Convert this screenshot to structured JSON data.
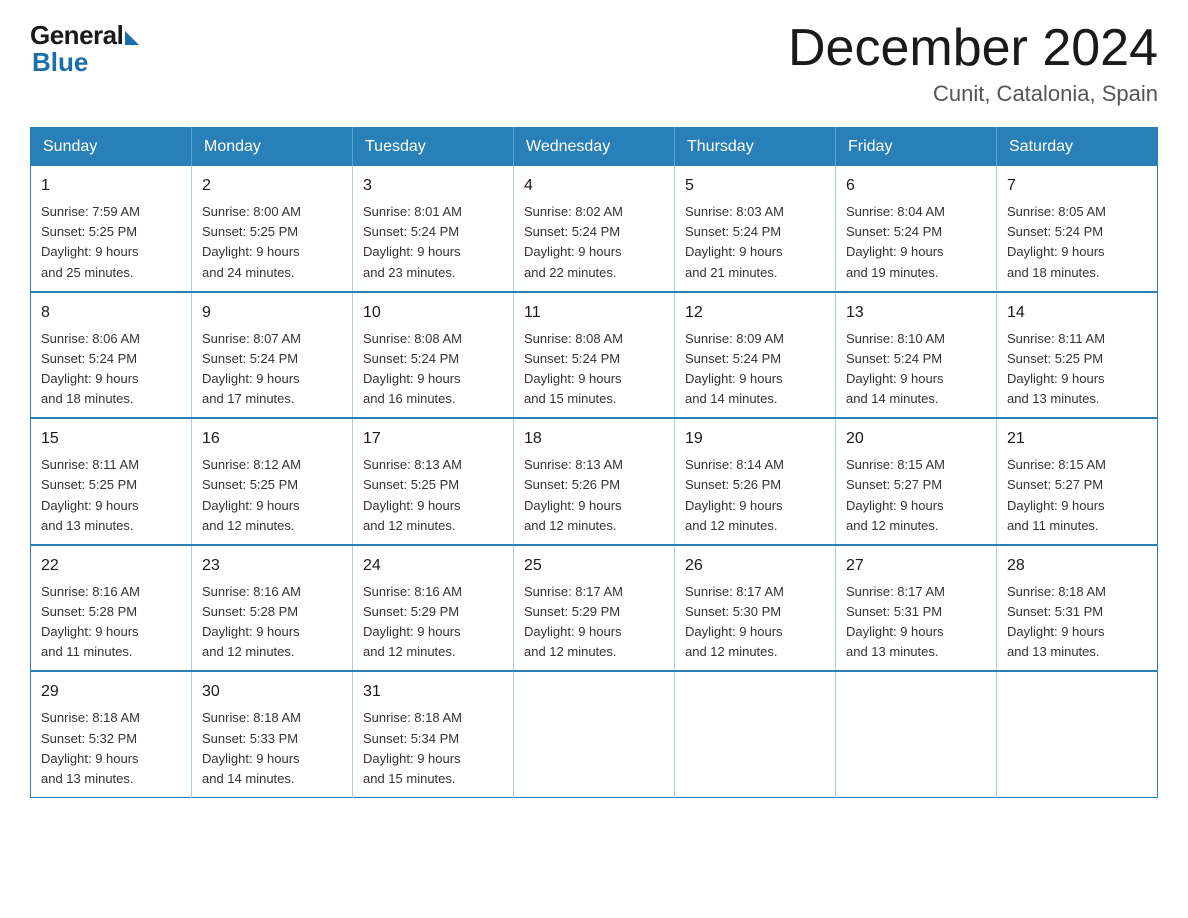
{
  "logo": {
    "general": "General",
    "blue": "Blue"
  },
  "title": "December 2024",
  "location": "Cunit, Catalonia, Spain",
  "days_of_week": [
    "Sunday",
    "Monday",
    "Tuesday",
    "Wednesday",
    "Thursday",
    "Friday",
    "Saturday"
  ],
  "weeks": [
    [
      {
        "day": "1",
        "sunrise": "7:59 AM",
        "sunset": "5:25 PM",
        "daylight": "9 hours and 25 minutes."
      },
      {
        "day": "2",
        "sunrise": "8:00 AM",
        "sunset": "5:25 PM",
        "daylight": "9 hours and 24 minutes."
      },
      {
        "day": "3",
        "sunrise": "8:01 AM",
        "sunset": "5:24 PM",
        "daylight": "9 hours and 23 minutes."
      },
      {
        "day": "4",
        "sunrise": "8:02 AM",
        "sunset": "5:24 PM",
        "daylight": "9 hours and 22 minutes."
      },
      {
        "day": "5",
        "sunrise": "8:03 AM",
        "sunset": "5:24 PM",
        "daylight": "9 hours and 21 minutes."
      },
      {
        "day": "6",
        "sunrise": "8:04 AM",
        "sunset": "5:24 PM",
        "daylight": "9 hours and 19 minutes."
      },
      {
        "day": "7",
        "sunrise": "8:05 AM",
        "sunset": "5:24 PM",
        "daylight": "9 hours and 18 minutes."
      }
    ],
    [
      {
        "day": "8",
        "sunrise": "8:06 AM",
        "sunset": "5:24 PM",
        "daylight": "9 hours and 18 minutes."
      },
      {
        "day": "9",
        "sunrise": "8:07 AM",
        "sunset": "5:24 PM",
        "daylight": "9 hours and 17 minutes."
      },
      {
        "day": "10",
        "sunrise": "8:08 AM",
        "sunset": "5:24 PM",
        "daylight": "9 hours and 16 minutes."
      },
      {
        "day": "11",
        "sunrise": "8:08 AM",
        "sunset": "5:24 PM",
        "daylight": "9 hours and 15 minutes."
      },
      {
        "day": "12",
        "sunrise": "8:09 AM",
        "sunset": "5:24 PM",
        "daylight": "9 hours and 14 minutes."
      },
      {
        "day": "13",
        "sunrise": "8:10 AM",
        "sunset": "5:24 PM",
        "daylight": "9 hours and 14 minutes."
      },
      {
        "day": "14",
        "sunrise": "8:11 AM",
        "sunset": "5:25 PM",
        "daylight": "9 hours and 13 minutes."
      }
    ],
    [
      {
        "day": "15",
        "sunrise": "8:11 AM",
        "sunset": "5:25 PM",
        "daylight": "9 hours and 13 minutes."
      },
      {
        "day": "16",
        "sunrise": "8:12 AM",
        "sunset": "5:25 PM",
        "daylight": "9 hours and 12 minutes."
      },
      {
        "day": "17",
        "sunrise": "8:13 AM",
        "sunset": "5:25 PM",
        "daylight": "9 hours and 12 minutes."
      },
      {
        "day": "18",
        "sunrise": "8:13 AM",
        "sunset": "5:26 PM",
        "daylight": "9 hours and 12 minutes."
      },
      {
        "day": "19",
        "sunrise": "8:14 AM",
        "sunset": "5:26 PM",
        "daylight": "9 hours and 12 minutes."
      },
      {
        "day": "20",
        "sunrise": "8:15 AM",
        "sunset": "5:27 PM",
        "daylight": "9 hours and 12 minutes."
      },
      {
        "day": "21",
        "sunrise": "8:15 AM",
        "sunset": "5:27 PM",
        "daylight": "9 hours and 11 minutes."
      }
    ],
    [
      {
        "day": "22",
        "sunrise": "8:16 AM",
        "sunset": "5:28 PM",
        "daylight": "9 hours and 11 minutes."
      },
      {
        "day": "23",
        "sunrise": "8:16 AM",
        "sunset": "5:28 PM",
        "daylight": "9 hours and 12 minutes."
      },
      {
        "day": "24",
        "sunrise": "8:16 AM",
        "sunset": "5:29 PM",
        "daylight": "9 hours and 12 minutes."
      },
      {
        "day": "25",
        "sunrise": "8:17 AM",
        "sunset": "5:29 PM",
        "daylight": "9 hours and 12 minutes."
      },
      {
        "day": "26",
        "sunrise": "8:17 AM",
        "sunset": "5:30 PM",
        "daylight": "9 hours and 12 minutes."
      },
      {
        "day": "27",
        "sunrise": "8:17 AM",
        "sunset": "5:31 PM",
        "daylight": "9 hours and 13 minutes."
      },
      {
        "day": "28",
        "sunrise": "8:18 AM",
        "sunset": "5:31 PM",
        "daylight": "9 hours and 13 minutes."
      }
    ],
    [
      {
        "day": "29",
        "sunrise": "8:18 AM",
        "sunset": "5:32 PM",
        "daylight": "9 hours and 13 minutes."
      },
      {
        "day": "30",
        "sunrise": "8:18 AM",
        "sunset": "5:33 PM",
        "daylight": "9 hours and 14 minutes."
      },
      {
        "day": "31",
        "sunrise": "8:18 AM",
        "sunset": "5:34 PM",
        "daylight": "9 hours and 15 minutes."
      },
      null,
      null,
      null,
      null
    ]
  ],
  "labels": {
    "sunrise": "Sunrise:",
    "sunset": "Sunset:",
    "daylight": "Daylight:"
  }
}
